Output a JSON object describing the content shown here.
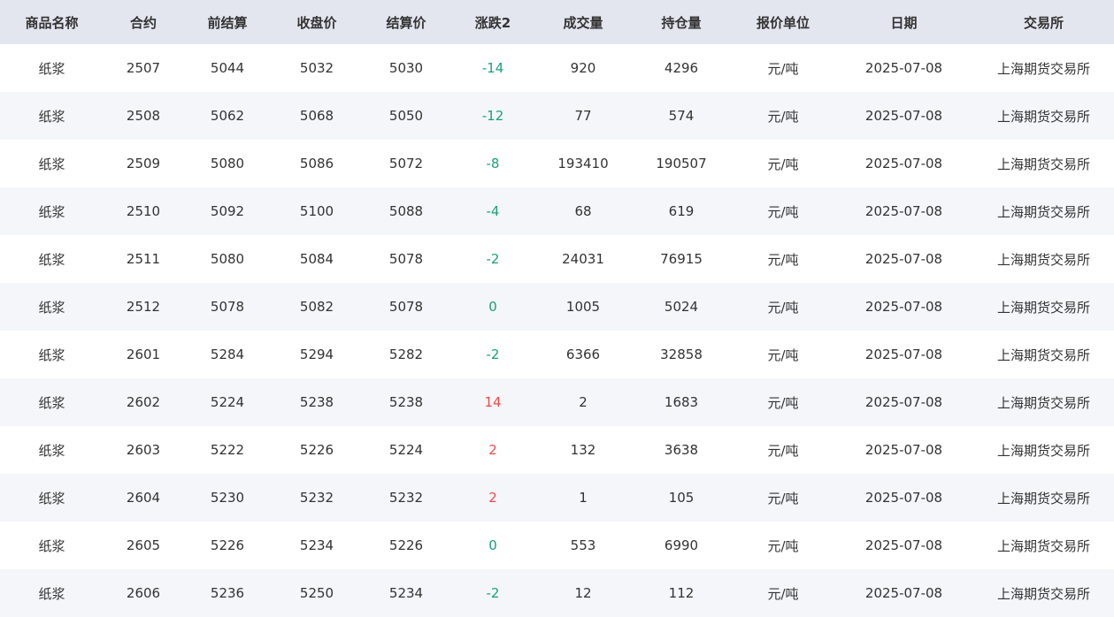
{
  "table": {
    "columns": [
      "商品名称",
      "合约",
      "前结算",
      "收盘价",
      "结算价",
      "涨跌2",
      "成交量",
      "持仓量",
      "报价单位",
      "日期",
      "交易所"
    ],
    "rows": [
      [
        "纸浆",
        "2507",
        "5044",
        "5032",
        "5030",
        "-14",
        "920",
        "4296",
        "元/吨",
        "2025-07-08",
        "上海期货交易所"
      ],
      [
        "纸浆",
        "2508",
        "5062",
        "5068",
        "5050",
        "-12",
        "77",
        "574",
        "元/吨",
        "2025-07-08",
        "上海期货交易所"
      ],
      [
        "纸浆",
        "2509",
        "5080",
        "5086",
        "5072",
        "-8",
        "193410",
        "190507",
        "元/吨",
        "2025-07-08",
        "上海期货交易所"
      ],
      [
        "纸浆",
        "2510",
        "5092",
        "5100",
        "5088",
        "-4",
        "68",
        "619",
        "元/吨",
        "2025-07-08",
        "上海期货交易所"
      ],
      [
        "纸浆",
        "2511",
        "5080",
        "5084",
        "5078",
        "-2",
        "24031",
        "76915",
        "元/吨",
        "2025-07-08",
        "上海期货交易所"
      ],
      [
        "纸浆",
        "2512",
        "5078",
        "5082",
        "5078",
        "0",
        "1005",
        "5024",
        "元/吨",
        "2025-07-08",
        "上海期货交易所"
      ],
      [
        "纸浆",
        "2601",
        "5284",
        "5294",
        "5282",
        "-2",
        "6366",
        "32858",
        "元/吨",
        "2025-07-08",
        "上海期货交易所"
      ],
      [
        "纸浆",
        "2602",
        "5224",
        "5238",
        "5238",
        "14",
        "2",
        "1683",
        "元/吨",
        "2025-07-08",
        "上海期货交易所"
      ],
      [
        "纸浆",
        "2603",
        "5222",
        "5226",
        "5224",
        "2",
        "132",
        "3638",
        "元/吨",
        "2025-07-08",
        "上海期货交易所"
      ],
      [
        "纸浆",
        "2604",
        "5230",
        "5232",
        "5232",
        "2",
        "1",
        "105",
        "元/吨",
        "2025-07-08",
        "上海期货交易所"
      ],
      [
        "纸浆",
        "2605",
        "5226",
        "5234",
        "5226",
        "0",
        "553",
        "6990",
        "元/吨",
        "2025-07-08",
        "上海期货交易所"
      ],
      [
        "纸浆",
        "2606",
        "5236",
        "5250",
        "5234",
        "-2",
        "12",
        "112",
        "元/吨",
        "2025-07-08",
        "上海期货交易所"
      ]
    ]
  },
  "colors": {
    "header_bg": "#e3e5ef",
    "row_alt_bg": "#f4f6f9",
    "up": "#f04a4a",
    "down": "#1aa17a",
    "flat": "#1aa17a"
  }
}
